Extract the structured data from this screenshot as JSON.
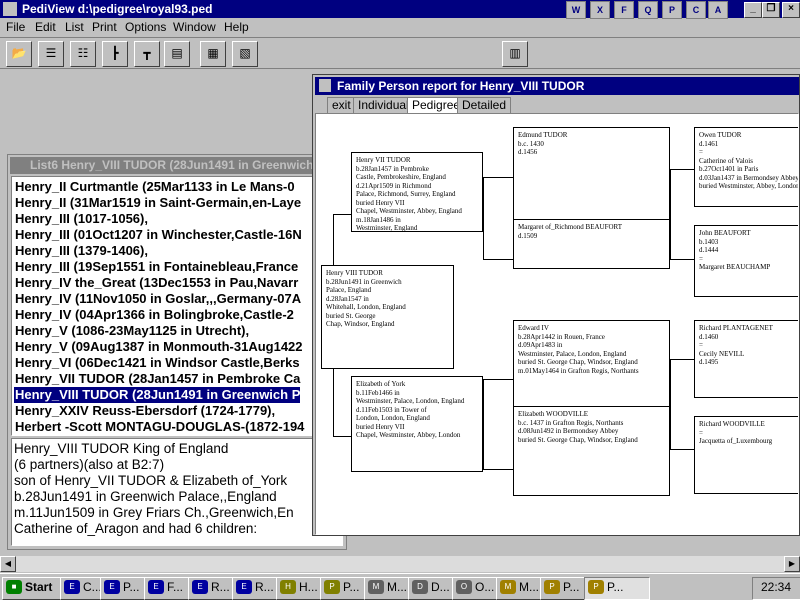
{
  "app": {
    "title": "PediView d:\\pedigree\\royal93.ped",
    "win_buttons": [
      "_",
      "❐",
      "×"
    ],
    "quick_icons": [
      "W",
      "X",
      "F",
      "Q",
      "P",
      "C",
      "A",
      "X"
    ]
  },
  "menu": [
    "File",
    "Edit",
    "List",
    "Print",
    "Options",
    "Window",
    "Help"
  ],
  "list_window": {
    "title": "List6  Henry_VIII TUDOR (28Jun1491 in Greenwich P",
    "items": [
      "Henry_II Curtmantle (25Mar1133 in Le Mans-0",
      "Henry_II (31Mar1519 in Saint-Germain,en-Laye",
      "Henry_III (1017-1056),",
      "Henry_III (01Oct1207 in Winchester,Castle-16N",
      "Henry_III (1379-1406),",
      "Henry_III (19Sep1551 in Fontainebleau,France",
      "Henry_IV the_Great (13Dec1553 in Pau,Navarr",
      "Henry_IV (11Nov1050 in Goslar,,,Germany-07A",
      "Henry_IV (04Apr1366 in Bolingbroke,Castle-2",
      "Henry_V (1086-23May1125 in Utrecht),",
      "Henry_V (09Aug1387 in Monmouth-31Aug1422",
      "Henry_VI (06Dec1421 in Windsor Castle,Berks",
      "Henry_VII TUDOR (28Jan1457 in Pembroke Ca",
      "Henry_VIII TUDOR (28Jun1491 in Greenwich P",
      "Henry_XXIV Reuss-Ebersdorf (1724-1779),",
      "Herbert -Scott MONTAGU-DOUGLAS-(1872-194"
    ],
    "selected_index": 13,
    "details": [
      "Henry_VIII TUDOR King of England",
      "(6 partners)(also at B2:7)",
      "son of Henry_VII TUDOR & Elizabeth of_York",
      "b.28Jun1491 in Greenwich Palace,,England",
      " m.11Jun1509 in Grey Friars Ch.,Greenwich,En",
      "Catherine of_Aragon and had 6 children:"
    ]
  },
  "report_window": {
    "title": "Family Person report for Henry_VIII TUDOR",
    "tabs": [
      "exit",
      "Individual",
      "Pedigree",
      "Detailed"
    ],
    "active_tab": "Pedigree",
    "boxes": {
      "subject": [
        "Henry VIII TUDOR",
        "b.28Jun1491 in Greenwich",
        "Palace, England",
        "d.28Jan1547 in",
        "Whitehall, London, England",
        "buried St. George",
        "Chap, Windsor, England"
      ],
      "father": [
        "Henry VII TUDOR",
        "b.28Jan1457 in Pembroke",
        "Castle, Pembrokeshire, England",
        "d.21Apr1509 in Richmond",
        "Palace, Richmond, Surrey, England",
        "buried Henry VII",
        "Chapel, Westminster, Abbey, England",
        "m.18Jan1486 in",
        "Westminster, England"
      ],
      "mother": [
        "Elizabeth of York",
        "b.11Feb1466 in",
        "Westminster, Palace, London, England",
        "d.11Feb1503 in Tower of",
        "London, London, England",
        "buried Henry VII",
        "Chapel, Westminster, Abbey, London"
      ],
      "ff": [
        "Edmund TUDOR",
        "b.c. 1430",
        "d.1456"
      ],
      "fm": [
        "Margaret of_Richmond BEAUFORT",
        "d.1509"
      ],
      "mf": [
        "Edward IV",
        "b.28Apr1442 in Rouen, France",
        "d.09Apr1483 in",
        "Westminster, Palace, London, England",
        "buried St. George Chap, Windsor, England",
        "m.01May1464 in Grafton Regis, Northants"
      ],
      "mm": [
        "Elizabeth WOODVILLE",
        "b.c. 1437 in Grafton Regis, Northants",
        "d.08Jun1492 in Bermondsey Abbey",
        "buried St. George Chap, Windsor, England"
      ],
      "fff": [
        "Owen TUDOR",
        "d.1461",
        "=",
        "Catherine of Valois",
        "b.27Oct1401 in Paris",
        "d.03Jan1437 in Bermondsey Abbey",
        "buried Westminster, Abbey, London"
      ],
      "ffm": [
        "John BEAUFORT",
        "b.1403",
        "d.1444",
        "=",
        "Margaret BEAUCHAMP"
      ],
      "mff": [
        "Richard PLANTAGENET",
        "d.1460",
        "=",
        "Cecily NEVILL",
        "d.1495"
      ],
      "mfm": [
        "Richard WOODVILLE",
        "=",
        "Jacquetta of_Luxembourg"
      ]
    }
  },
  "taskbar": {
    "start": "Start",
    "tasks": [
      "C...",
      "P...",
      "F...",
      "R...",
      "R...",
      "H...",
      "P...",
      "M...",
      "D...",
      "O...",
      "M...",
      "P...",
      "P..."
    ],
    "clock": "22:34"
  }
}
